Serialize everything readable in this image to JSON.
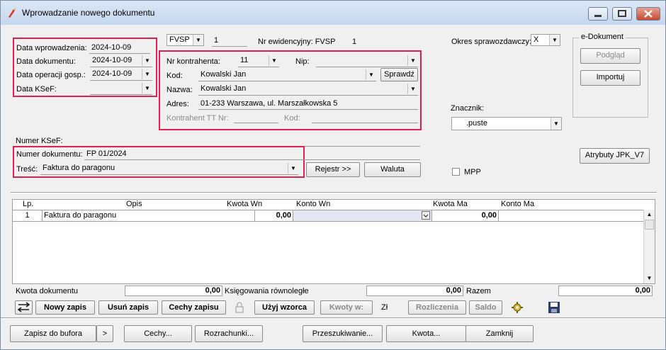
{
  "window": {
    "title": "Wprowadzanie nowego dokumentu"
  },
  "dates": {
    "entry_label": "Data wprowadzenia:",
    "entry_value": "2024-10-09",
    "doc_label": "Data dokumentu:",
    "doc_value": "2024-10-09",
    "op_label": "Data operacji gosp.:",
    "op_value": "2024-10-09",
    "ksef_label": "Data KSeF:",
    "ksef_value": ""
  },
  "series": {
    "type_value": "FVSP",
    "number_value": "1",
    "ewid_label": "Nr ewidencyjny: FVSP",
    "ewid_number": "1"
  },
  "period": {
    "label": "Okres sprawozdawczy:",
    "value": "X"
  },
  "edocument": {
    "group_label": "e-Dokument",
    "preview_button": "Podgląd",
    "import_button": "Importuj"
  },
  "contractor": {
    "nr_label": "Nr kontrahenta:",
    "nr_value": "11",
    "nip_label": "Nip:",
    "nip_value": "",
    "kod_label": "Kod:",
    "kod_value": "Kowalski Jan",
    "check_button": "Sprawdź",
    "name_label": "Nazwa:",
    "name_value": "Kowalski Jan",
    "address_label": "Adres:",
    "address_value": "01-233 Warszawa, ul. Marszałkowska 5",
    "tt_label": "Kontrahent TT Nr:",
    "tt_value": "",
    "tt_kod_label": "Kod:",
    "tt_kod_value": ""
  },
  "marker": {
    "label": "Znacznik:",
    "value": ".puste"
  },
  "mpp": {
    "label": "MPP",
    "checked": false
  },
  "jpk_button": "Atrybuty JPK_V7",
  "document": {
    "ksef_number_label": "Numer KSeF:",
    "ksef_number_value": "",
    "number_label": "Numer dokumentu:",
    "number_value": "FP 01/2024",
    "content_label": "Treść:",
    "content_value": "Faktura do paragonu",
    "register_button": "Rejestr >>",
    "currency_button": "Waluta"
  },
  "grid": {
    "headers": [
      "Lp.",
      "Opis",
      "Kwota Wn",
      "Konto Wn",
      "Kwota Ma",
      "Konto Ma"
    ],
    "rows": [
      {
        "lp": "1",
        "opis": "Faktura do paragonu",
        "kwota_wn": "0,00",
        "konto_wn": "",
        "kwota_ma": "0,00",
        "konto_ma": ""
      }
    ]
  },
  "summary": {
    "doc_amount_label": "Kwota dokumentu",
    "doc_amount_value": "0,00",
    "parallel_label": "Księgowania równoległe",
    "parallel_value": "0,00",
    "total_label": "Razem",
    "total_value": "0,00"
  },
  "toolbar": {
    "new_entry": "Nowy zapis",
    "delete_entry": "Usuń zapis",
    "entry_features": "Cechy zapisu",
    "use_template": "Użyj wzorca",
    "amounts": "Kwoty w:",
    "currency": "Zł",
    "settlements": "Rozliczenia",
    "balance": "Saldo"
  },
  "bottom": {
    "save_buffer": "Zapisz do bufora",
    "more": ">",
    "features": "Cechy...",
    "settlements": "Rozrachunki...",
    "search": "Przeszukiwanie...",
    "amount": "Kwota...",
    "close": "Zamknij"
  }
}
